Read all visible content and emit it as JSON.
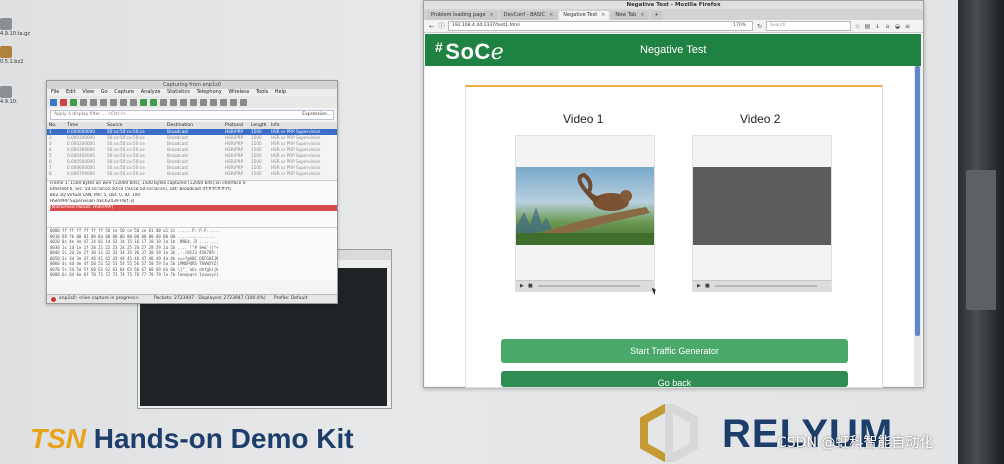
{
  "desktop": {
    "icons": [
      "4.9.10.ta.gz",
      "0.5.1.bz2",
      "4.9.10."
    ]
  },
  "wireshark": {
    "title": "Capturing from enp1s0",
    "menu": [
      "File",
      "Edit",
      "View",
      "Go",
      "Capture",
      "Analyze",
      "Statistics",
      "Telephony",
      "Wireless",
      "Tools",
      "Help"
    ],
    "filter_placeholder": "Apply a display filter ... <Ctrl-/>",
    "filter_expression": "Expression...",
    "columns": [
      "No.",
      "Time",
      "Source",
      "Destination",
      "Protocol",
      "Length",
      "Info"
    ],
    "packets": [
      [
        "1",
        "0.000000000",
        "50:ce:50:ce:50:ce",
        "Broadcast",
        "HSR/PRP",
        "1500",
        "HSR or PRP Supervision"
      ],
      [
        "2",
        "0.000100000",
        "50:ce:50:ce:50:ce",
        "Broadcast",
        "HSR/PRP",
        "1500",
        "HSR or PRP Supervision"
      ],
      [
        "3",
        "0.000200000",
        "50:ce:50:ce:50:ce",
        "Broadcast",
        "HSR/PRP",
        "1500",
        "HSR or PRP Supervision"
      ],
      [
        "4",
        "0.000300000",
        "50:ce:50:ce:50:ce",
        "Broadcast",
        "HSR/PRP",
        "1500",
        "HSR or PRP Supervision"
      ],
      [
        "5",
        "0.000400000",
        "50:ce:50:ce:50:ce",
        "Broadcast",
        "HSR/PRP",
        "1500",
        "HSR or PRP Supervision"
      ],
      [
        "6",
        "0.000500000",
        "50:ce:50:ce:50:ce",
        "Broadcast",
        "HSR/PRP",
        "1500",
        "HSR or PRP Supervision"
      ],
      [
        "7",
        "0.000600000",
        "50:ce:50:ce:50:ce",
        "Broadcast",
        "HSR/PRP",
        "1500",
        "HSR or PRP Supervision"
      ],
      [
        "8",
        "0.000700000",
        "50:ce:50:ce:50:ce",
        "Broadcast",
        "HSR/PRP",
        "1500",
        "HSR or PRP Supervision"
      ]
    ],
    "details": [
      "Frame 1: 1500 bytes on wire (12000 bits), 1500 bytes captured (12000 bits) on interface 0",
      "Ethernet II, Src: 50:ce:50:ce:50:ce (50:ce:50:ce:50:ce), Dst: Broadcast (ff:ff:ff:ff:ff:ff)",
      "802.1Q Virtual LAN, PRI: 5, DEI: 0, ID: 100",
      "HSR/PRP Supervision (IEC62439 Part 3)",
      "[Malformed Packet: HSR/PRP]"
    ],
    "hex_rows": [
      "0000  ff ff ff ff ff ff 50 ce 50 ce 50 ce 81 00 a1 2c   ......P. P.P....,",
      "0010  88 fb 00 01 00 0a 00 00 00 00 00 00 00 00 00 00   ................",
      "0020  0c 4e 4e 47 24 01 1d 52 14 15 16 17 18 19 1a 1b   .NNG$..R ........",
      "0030  1c 1d 1e 1f 20 21 22 23 24 25 26 27 28 29 2a 2b   .... !\"# $%&'()*+",
      "0040  2c 2d 2e 2f 30 31 32 33 34 35 36 37 38 39 3a 3b   ,-./0123 456789:;",
      "0050  3c 3d 3e 3f 40 41 42 43 44 45 46 47 48 49 4a 4b   <=>?@ABC DEFGHIJK",
      "0060  4c 4d 4e 4f 50 51 52 53 54 55 56 57 58 59 5a 5b   LMNOPQRS TUVWXYZ[",
      "0070  5c 5d 5e 5f 60 61 62 63 64 65 66 67 68 69 6a 6b   \\]^_`abc defghijk",
      "0080  6c 6d 6e 6f 70 71 72 73 74 75 76 77 78 79 7a 7b   lmnopqrs tuvwxyz{"
    ],
    "status_interface": "enp1s0: <live capture in progress>",
    "status_packets": "Packets: 2723947 · Displayed: 2723947 (100.0%)",
    "status_profile": "Profile: Default"
  },
  "firefox": {
    "window_title": "Negative Test - Mozilla Firefox",
    "tabs": [
      {
        "label": "Problem loading page"
      },
      {
        "label": "DevConf - BASIC"
      },
      {
        "label": "Negative Test"
      },
      {
        "label": "New Tab"
      }
    ],
    "url": "192.168.4.44:1337/test1.html",
    "zoom": "170%",
    "search_placeholder": "Search"
  },
  "page": {
    "logo": {
      "main": "SoC",
      "tail": "e"
    },
    "header_title": "Negative Test",
    "video1_label": "Video 1",
    "video2_label": "Video 2",
    "start_button": "Start Traffic Generator",
    "back_button": "Go back"
  },
  "branding": {
    "tsn": "TSN",
    "kit": "Hands-on Demo Kit",
    "company": "RELYUM"
  },
  "watermark": "CSDN @虹科智能自动化",
  "colors": {
    "header_green": "#1f8142",
    "button_green": "#4aa96a",
    "brand_navy": "#1d3d6b",
    "brand_gold": "#e7a31c"
  }
}
